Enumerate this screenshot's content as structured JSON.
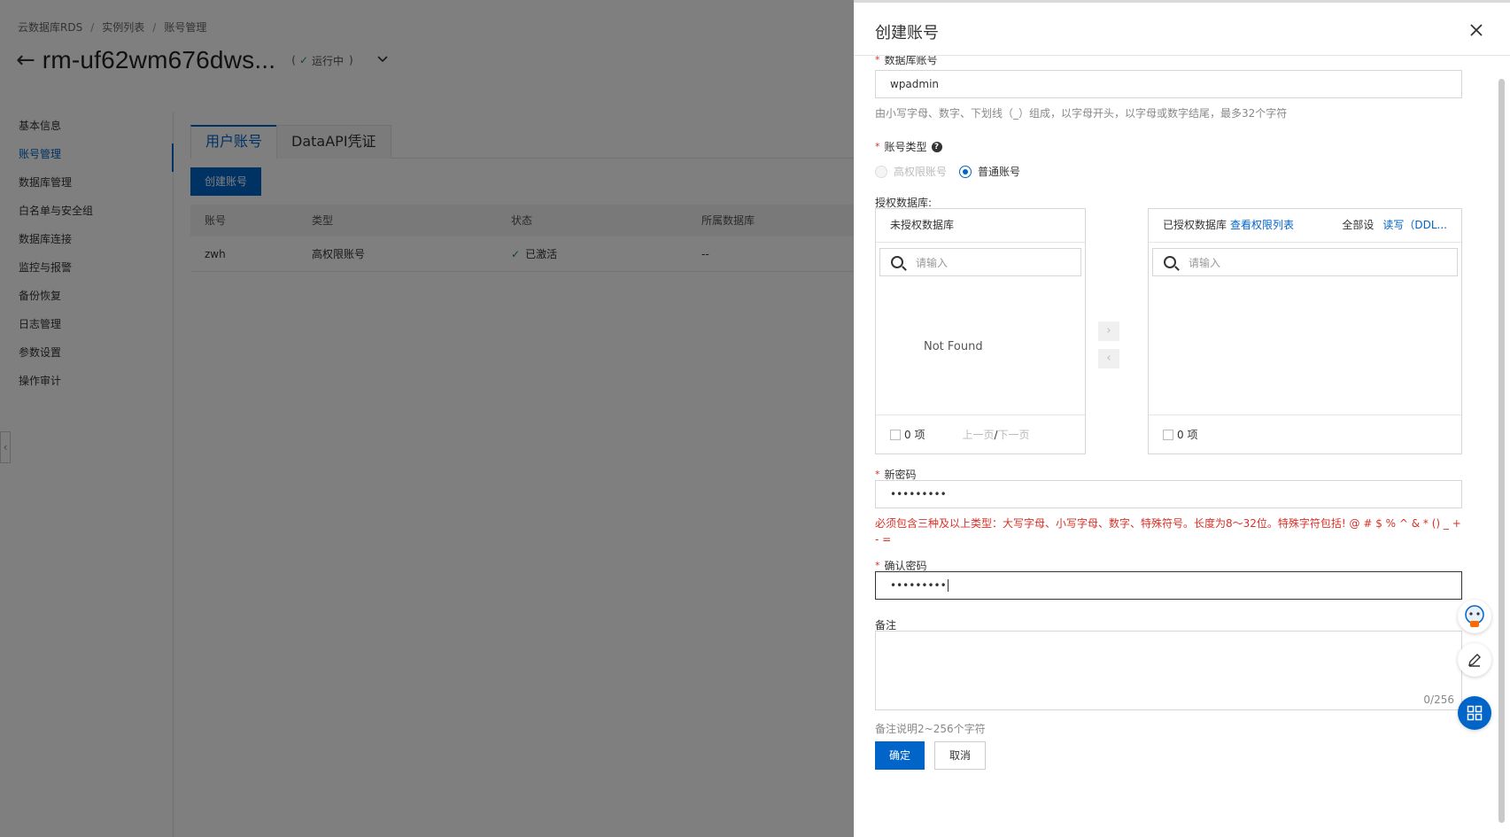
{
  "breadcrumb": [
    "云数据库RDS",
    "实例列表",
    "账号管理"
  ],
  "instance": {
    "name": "rm-uf62wm676dws...",
    "status_prefix": "(",
    "status": "运行中",
    "status_suffix": ")"
  },
  "left_nav": [
    "基本信息",
    "账号管理",
    "数据库管理",
    "白名单与安全组",
    "数据库连接",
    "监控与报警",
    "备份恢复",
    "日志管理",
    "参数设置",
    "操作审计"
  ],
  "tabs": [
    "用户账号",
    "DataAPI凭证"
  ],
  "create_button": "创建账号",
  "table": {
    "headers": [
      "账号",
      "类型",
      "状态",
      "所属数据库"
    ],
    "rows": [
      {
        "account": "zwh",
        "type": "高权限账号",
        "status": "已激活",
        "db": "--"
      }
    ]
  },
  "drawer": {
    "title": "创建账号",
    "db_account": {
      "label": "数据库账号",
      "value": "wpadmin",
      "hint": "由小写字母、数字、下划线（_）组成，以字母开头，以字母或数字结尾，最多32个字符"
    },
    "account_type": {
      "label": "账号类型",
      "help": "?",
      "options": [
        "高权限账号",
        "普通账号"
      ]
    },
    "auth_db": {
      "label": "授权数据库:",
      "left": {
        "title": "未授权数据库",
        "placeholder": "请输入",
        "empty": "Not Found",
        "count": "0 项",
        "prev": "上一页",
        "slash": "/",
        "next": "下一页"
      },
      "right": {
        "title": "已授权数据库",
        "view_link": "查看权限列表",
        "all_set": "全部设",
        "readwrite": "读写（DDL...",
        "placeholder": "请输入",
        "count": "0 项"
      },
      "move_right": "›",
      "move_left": "‹"
    },
    "new_password": {
      "label": "新密码",
      "value": "•••••••••",
      "error": "必须包含三种及以上类型：大写字母、小写字母、数字、特殊符号。长度为8～32位。特殊字符包括! @ # $ % ^ & * () _ + - ="
    },
    "confirm_password": {
      "label": "确认密码",
      "value": "•••••••••"
    },
    "remark": {
      "label": "备注",
      "counter": "0/256",
      "hint": "备注说明2~256个字符"
    },
    "ok_button": "确定",
    "cancel_button": "取消"
  },
  "colors": {
    "primary": "#0064c8",
    "success": "#1e8e3e",
    "error": "#d93026"
  },
  "icons": {
    "close": "close-icon",
    "back": "arrow-left-icon",
    "search": "search-icon",
    "edit": "edit-icon",
    "apps": "apps-grid-icon",
    "assistant": "assistant-robot-icon"
  }
}
